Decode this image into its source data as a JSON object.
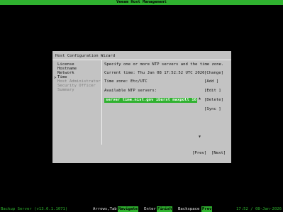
{
  "topbar": {
    "title": "Veeam Host Management"
  },
  "dialog": {
    "title": "Host Configuration Wizard",
    "nav": [
      {
        "label": "License",
        "state": "done"
      },
      {
        "label": "Hostname",
        "state": "done"
      },
      {
        "label": "Network",
        "state": "done"
      },
      {
        "label": "Time",
        "state": "current"
      },
      {
        "label": "Host Administrator",
        "state": "pending"
      },
      {
        "label": "Security Officer",
        "state": "pending"
      },
      {
        "label": "Summary",
        "state": "pending"
      }
    ],
    "nav_arrow": ">",
    "instruction": "Specify one or more NTP servers and the time zone.",
    "current_time": "Current time: Thu Jan 08 17:52:52 UTC 2026",
    "time_zone": "Time zone: Etc/UTC",
    "ntp_label": "Available NTP servers:",
    "ntp_servers": [
      "server time.nist.gov iburst maxpoll 16"
    ],
    "buttons": {
      "change": "[Change]",
      "add": "[Add  ]",
      "edit": "[Edit ]",
      "delete": "[Delete]",
      "sync": "[Sync ]",
      "prev": "[Prev]",
      "next": "[Next]"
    },
    "scroll_arrows": {
      "up": "▲",
      "down": "▼"
    }
  },
  "statusbar": {
    "left": "Backup Server (v13.0.1.1071)",
    "keys": [
      {
        "key": "Arrows,Tab",
        "action": "Navigate"
      },
      {
        "key": "Enter",
        "action": "Finish"
      },
      {
        "key": "Backspace",
        "action": "Prev"
      }
    ],
    "right": "17:52 / 08-Jan-2026"
  },
  "colors": {
    "accent": "#2fb12f",
    "dialog_bg": "#c3c3c3",
    "screen_bg": "#000000"
  }
}
